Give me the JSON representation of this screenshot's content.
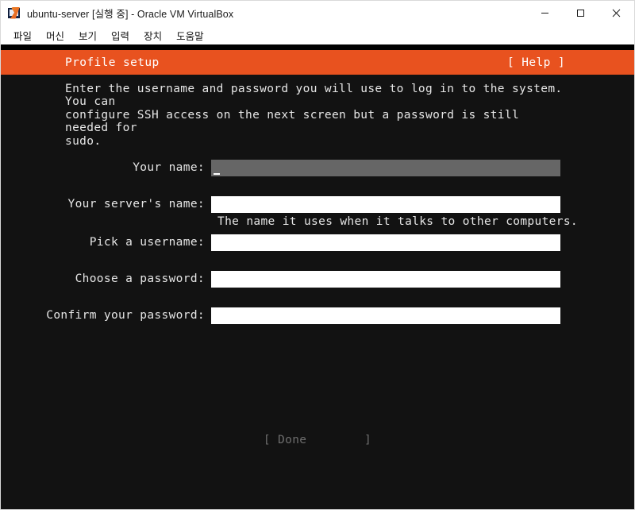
{
  "window": {
    "title": "ubuntu-server [실행 중] - Oracle VM VirtualBox",
    "icon": "virtualbox-icon",
    "controls": {
      "minimize": "minimize-icon",
      "maximize": "maximize-icon",
      "close": "close-icon"
    }
  },
  "menubar": {
    "items": [
      {
        "label": "파일"
      },
      {
        "label": "머신"
      },
      {
        "label": "보기"
      },
      {
        "label": "입력"
      },
      {
        "label": "장치"
      },
      {
        "label": "도움말"
      }
    ]
  },
  "installer": {
    "header": {
      "title": "Profile setup",
      "help_label": "[ Help ]",
      "background_color": "#e8521f",
      "text_color": "#ffffff"
    },
    "intro_text": "Enter the username and password you will use to log in to the system. You can\nconfigure SSH access on the next screen but a password is still needed for\nsudo.",
    "fields": [
      {
        "label": "Your name:",
        "value": "",
        "focused": true,
        "hint": ""
      },
      {
        "label": "Your server's name:",
        "value": "",
        "focused": false,
        "hint": "The name it uses when it talks to other computers."
      },
      {
        "label": "Pick a username:",
        "value": "",
        "focused": false,
        "hint": ""
      },
      {
        "label": "Choose a password:",
        "value": "",
        "focused": false,
        "hint": ""
      },
      {
        "label": "Confirm your password:",
        "value": "",
        "focused": false,
        "hint": ""
      }
    ],
    "done_button": {
      "label": "[ Done        ]",
      "enabled": false,
      "color": "#6e6e6e"
    },
    "terminal_background": "#121212",
    "terminal_text_color": "#e6e6e6"
  }
}
